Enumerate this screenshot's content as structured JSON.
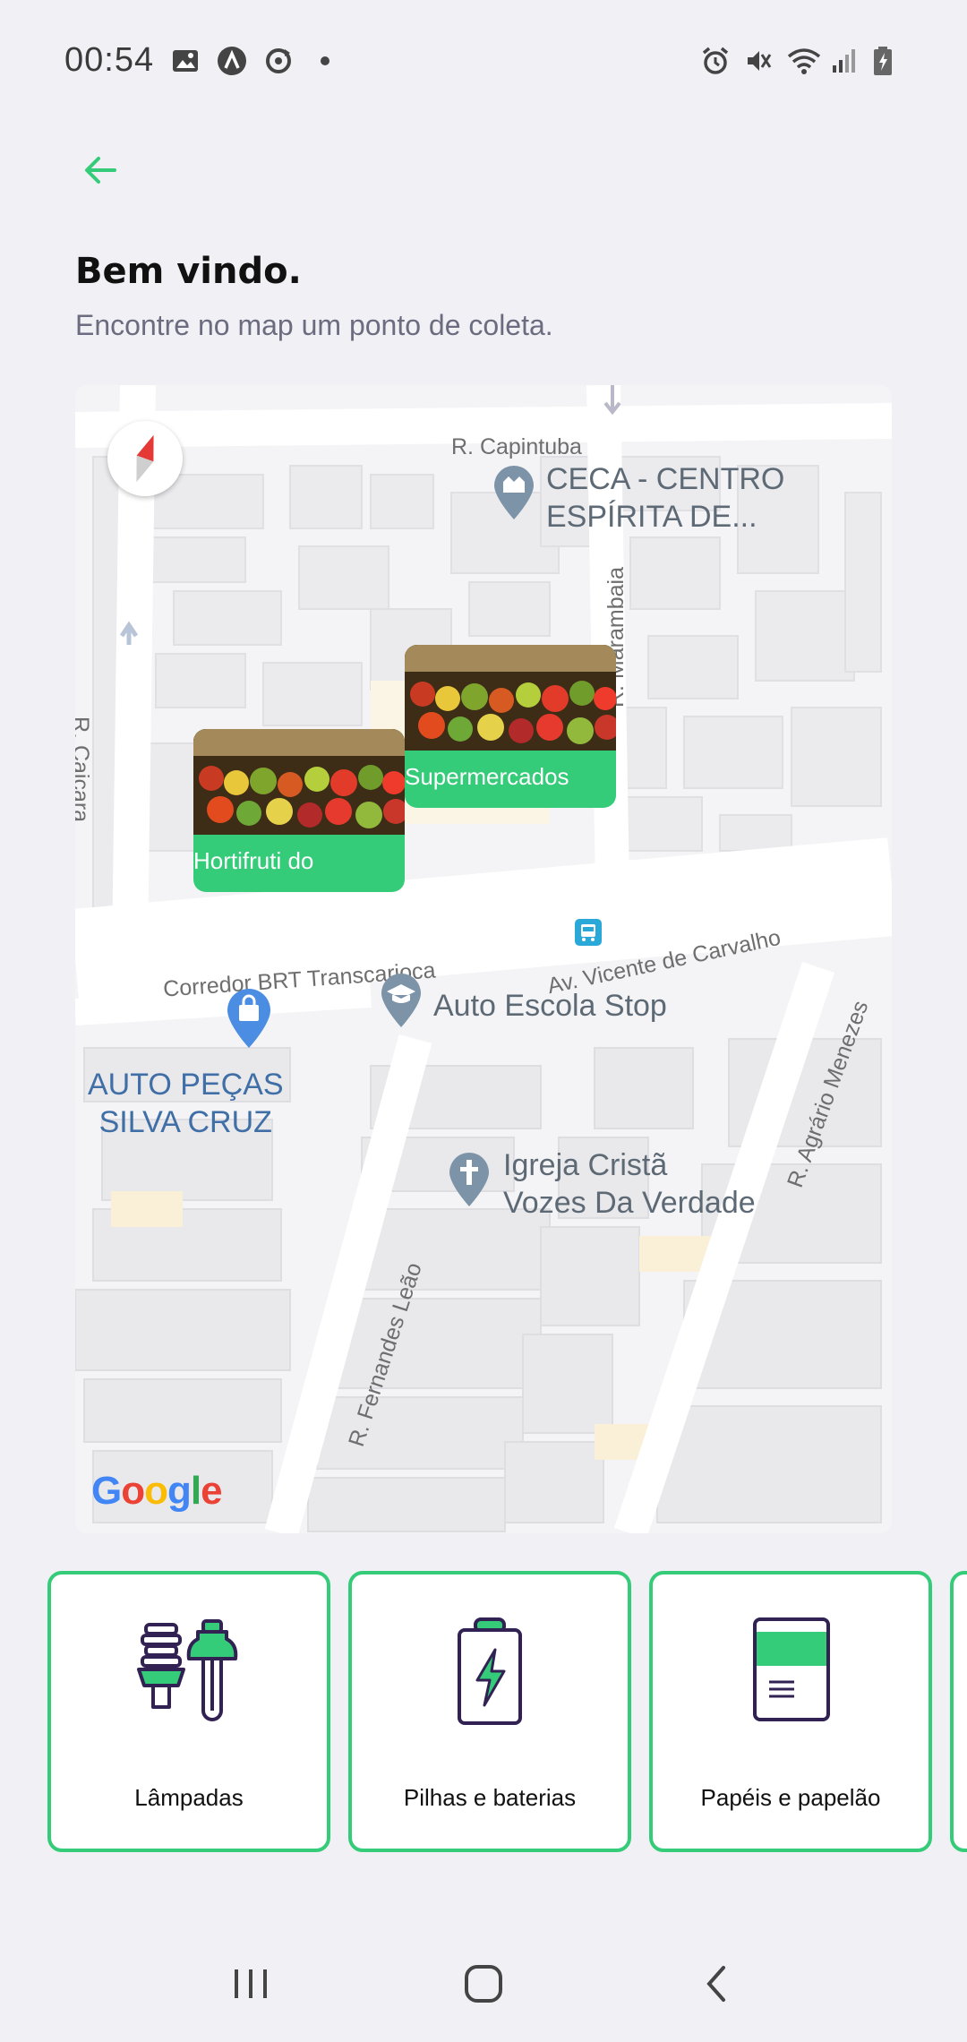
{
  "status_bar": {
    "time": "00:54",
    "left_icons": [
      "image-icon",
      "a-icon",
      "sync-icon",
      "dot-icon"
    ],
    "right_icons": [
      "alarm-icon",
      "mute-icon",
      "wifi-icon",
      "signal-icon",
      "battery-icon"
    ]
  },
  "header": {
    "title": "Bem vindo.",
    "subtitle": "Encontre no map um ponto de coleta."
  },
  "map": {
    "street_labels": {
      "capintuba": "R. Capintuba",
      "caicara": "R. Caiçara",
      "marambaia": "R. Marambaia",
      "brt": "Corredor BRT Transcarioca",
      "vicente": "Av. Vicente de Carvalho",
      "agrario": "R. Agrário Menezes",
      "fernandes": "R. Fernandes Leão"
    },
    "pois": {
      "ceca": "CECA - CENTRO\nESPÍRITA DE...",
      "auto_escola": "Auto Escola Stop",
      "auto_pecas": "AUTO PEÇAS\nSILVA CRUZ",
      "igreja": "Igreja Cristã\nVozes Da Verdade"
    },
    "markers": [
      {
        "name": "Hortifruti do"
      },
      {
        "name": "Supermercados"
      }
    ],
    "attribution": "Google"
  },
  "items": [
    {
      "label": "Lâmpadas",
      "icon": "lamp-icon"
    },
    {
      "label": "Pilhas e baterias",
      "icon": "battery-icon"
    },
    {
      "label": "Papéis e papelão",
      "icon": "paper-icon"
    }
  ],
  "colors": {
    "accent": "#34cb79",
    "title": "#111111",
    "subtitle": "#6c6c80",
    "background": "#f0f0f5",
    "dark": "#322153"
  }
}
